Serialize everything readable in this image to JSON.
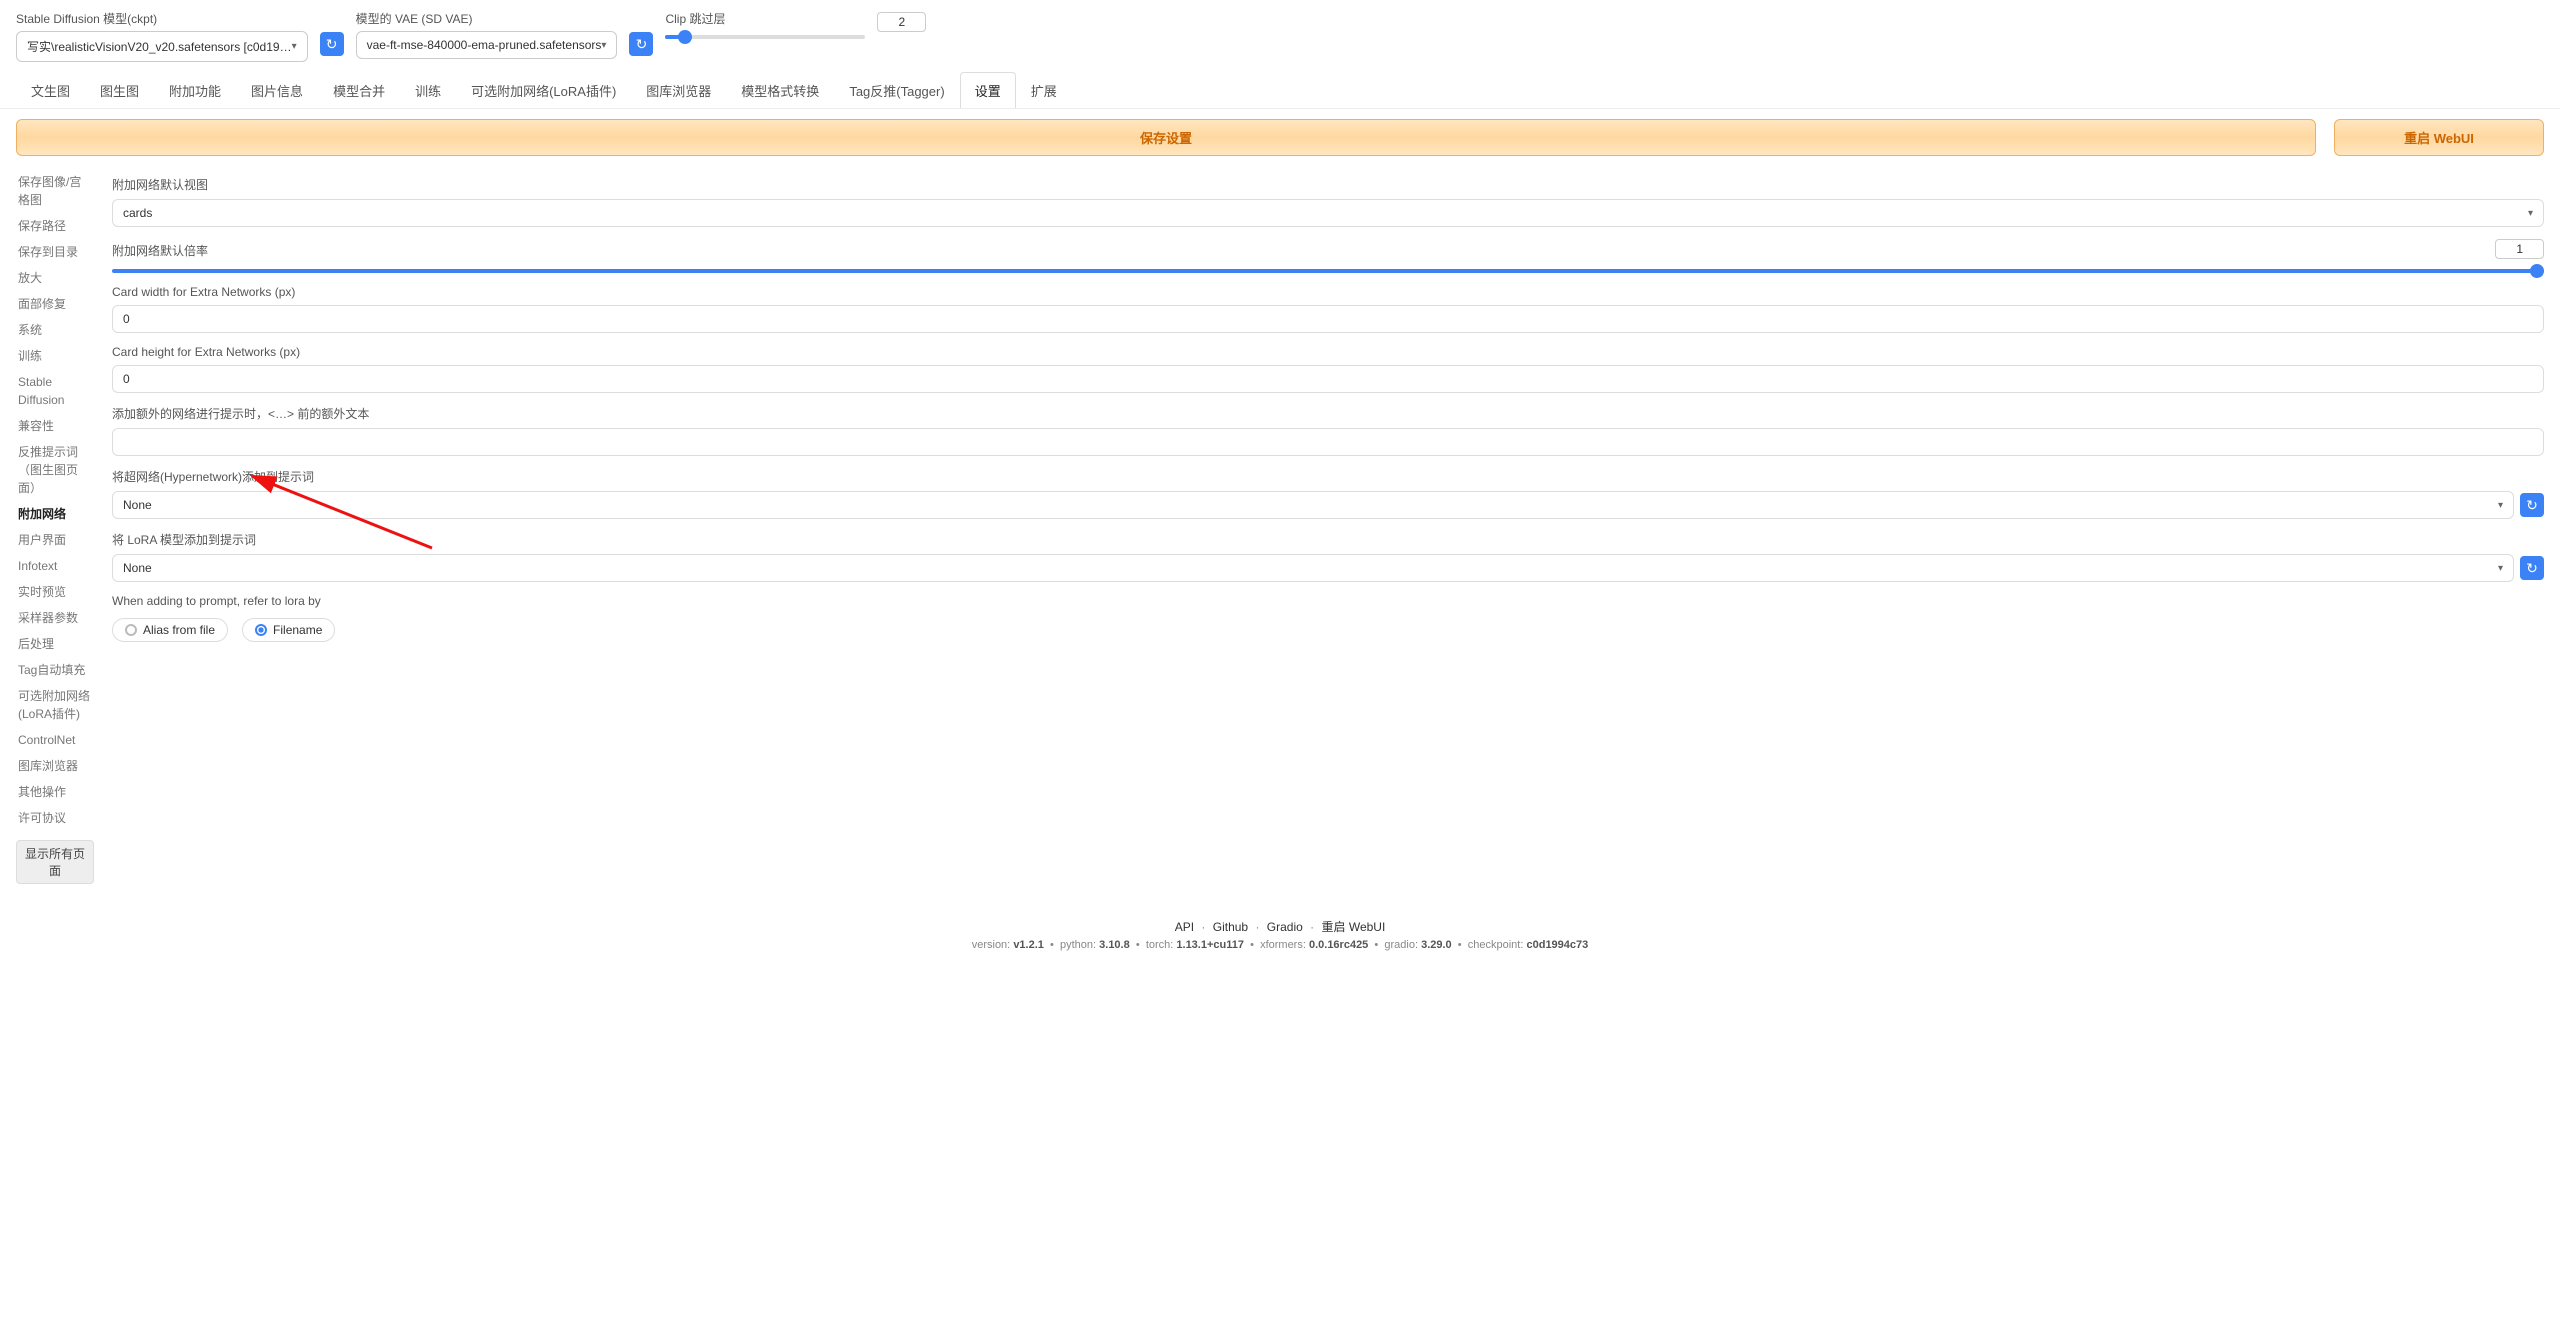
{
  "header": {
    "ckpt_label": "Stable Diffusion 模型(ckpt)",
    "ckpt_value": "写实\\realisticVisionV20_v20.safetensors [c0d19…",
    "vae_label": "模型的 VAE (SD VAE)",
    "vae_value": "vae-ft-mse-840000-ema-pruned.safetensors",
    "clip_label": "Clip 跳过层",
    "clip_value": "2"
  },
  "tabs": {
    "items": [
      "文生图",
      "图生图",
      "附加功能",
      "图片信息",
      "模型合并",
      "训练",
      "可选附加网络(LoRA插件)",
      "图库浏览器",
      "模型格式转换",
      "Tag反推(Tagger)",
      "设置",
      "扩展"
    ],
    "active_index": 10
  },
  "buttons": {
    "save": "保存设置",
    "restart": "重启 WebUI"
  },
  "sidebar": {
    "items": [
      "保存图像/宫格图",
      "保存路径",
      "保存到目录",
      "放大",
      "面部修复",
      "系统",
      "训练",
      "Stable Diffusion",
      "兼容性",
      "反推提示词（图生图页面）",
      "附加网络",
      "用户界面",
      "Infotext",
      "实时预览",
      "采样器参数",
      "后处理",
      "Tag自动填充",
      "可选附加网络(LoRA插件)",
      "ControlNet",
      "图库浏览器",
      "其他操作",
      "许可协议"
    ],
    "active_index": 10,
    "show_all": "显示所有页面"
  },
  "fields": {
    "default_view_label": "附加网络默认视图",
    "default_view_value": "cards",
    "multiplier_label": "附加网络默认倍率",
    "multiplier_value": "1",
    "card_width_label": "Card width for Extra Networks (px)",
    "card_width_value": "0",
    "card_height_label": "Card height for Extra Networks (px)",
    "card_height_value": "0",
    "extra_text_label": "添加额外的网络进行提示时，<…> 前的额外文本",
    "extra_text_value": "",
    "hyper_label": "将超网络(Hypernetwork)添加到提示词",
    "hyper_value": "None",
    "lora_label": "将 LoRA 模型添加到提示词",
    "lora_value": "None",
    "refer_label": "When adding to prompt, refer to lora by",
    "radio_alias": "Alias from file",
    "radio_filename": "Filename"
  },
  "footer": {
    "links": [
      "API",
      "Github",
      "Gradio",
      "重启 WebUI"
    ],
    "meta_version_lbl": "version:",
    "meta_version": "v1.2.1",
    "meta_python_lbl": "python:",
    "meta_python": "3.10.8",
    "meta_torch_lbl": "torch:",
    "meta_torch": "1.13.1+cu117",
    "meta_xformers_lbl": "xformers:",
    "meta_xformers": "0.0.16rc425",
    "meta_gradio_lbl": "gradio:",
    "meta_gradio": "3.29.0",
    "meta_ckpt_lbl": "checkpoint:",
    "meta_ckpt": "c0d1994c73"
  }
}
